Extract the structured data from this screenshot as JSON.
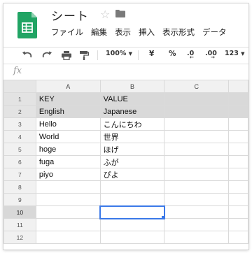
{
  "document": {
    "title": "シート"
  },
  "menu": [
    "ファイル",
    "編集",
    "表示",
    "挿入",
    "表示形式",
    "データ"
  ],
  "toolbar": {
    "zoom": "100%",
    "currency": "¥",
    "percent": "%",
    "decrease_decimals": ".0",
    "increase_decimals": ".00",
    "more_formats": "123"
  },
  "formula_bar": {
    "label": "fx",
    "value": ""
  },
  "sheet": {
    "columns": [
      "A",
      "B",
      "C"
    ],
    "rows": [
      {
        "num": "1",
        "a": "KEY",
        "b": "VALUE",
        "c": ""
      },
      {
        "num": "2",
        "a": "English",
        "b": "Japanese",
        "c": ""
      },
      {
        "num": "3",
        "a": "Hello",
        "b": "こんにちわ",
        "c": ""
      },
      {
        "num": "4",
        "a": "World",
        "b": "世界",
        "c": ""
      },
      {
        "num": "5",
        "a": "hoge",
        "b": "ほげ",
        "c": ""
      },
      {
        "num": "6",
        "a": "fuga",
        "b": "ふが",
        "c": ""
      },
      {
        "num": "7",
        "a": "piyo",
        "b": "ぴよ",
        "c": ""
      },
      {
        "num": "8",
        "a": "",
        "b": "",
        "c": ""
      },
      {
        "num": "9",
        "a": "",
        "b": "",
        "c": ""
      },
      {
        "num": "10",
        "a": "",
        "b": "",
        "c": ""
      },
      {
        "num": "11",
        "a": "",
        "b": "",
        "c": ""
      },
      {
        "num": "12",
        "a": "",
        "b": "",
        "c": ""
      }
    ]
  },
  "colors": {
    "brand": "#21a464",
    "selection": "#3b79e8",
    "header_row": "#d9d9d9"
  }
}
